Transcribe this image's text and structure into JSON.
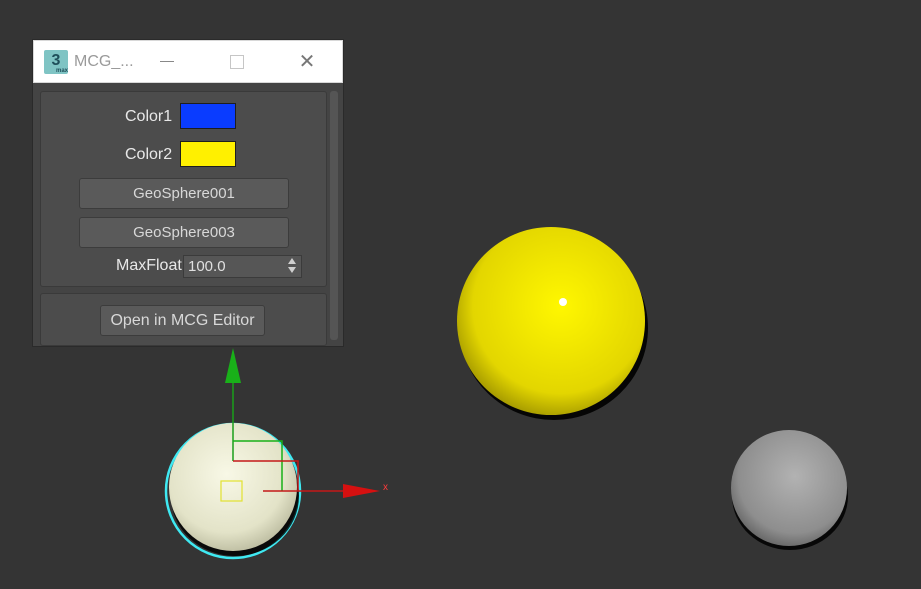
{
  "window": {
    "title": "MCG_...",
    "app_icon": "3ds-max-icon",
    "app_icon_text": "3"
  },
  "panel": {
    "color1": {
      "label": "Color1",
      "value": "#0a3cff"
    },
    "color2": {
      "label": "Color2",
      "value": "#fff000"
    },
    "buttons": [
      "GeoSphere001",
      "GeoSphere003"
    ],
    "maxfloat": {
      "label": "MaxFloat",
      "value": "100.0"
    },
    "open_editor_label": "Open in MCG Editor"
  },
  "viewport": {
    "background": "#343434",
    "objects": [
      {
        "name": "selected-sphere",
        "color": "#e8e8cc",
        "selected": true
      },
      {
        "name": "yellow-sphere",
        "color": "#f0e800"
      },
      {
        "name": "gray-sphere",
        "color": "#9a9a9a"
      }
    ],
    "gizmo": {
      "x_label": "x"
    }
  }
}
